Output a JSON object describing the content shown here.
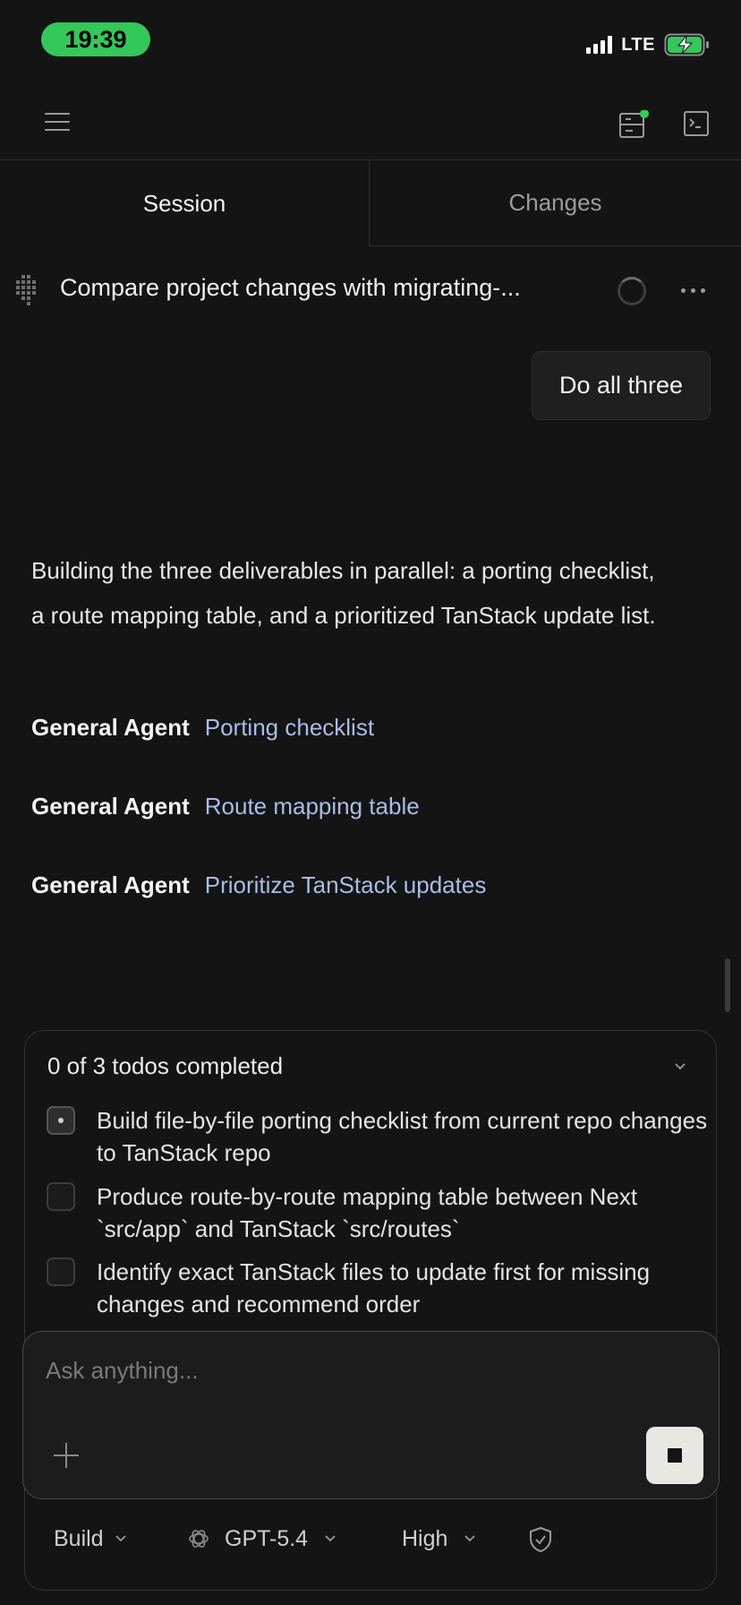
{
  "status_bar": {
    "time": "19:39",
    "network": "LTE"
  },
  "tabs": [
    {
      "label": "Session",
      "active": true
    },
    {
      "label": "Changes",
      "active": false
    }
  ],
  "session": {
    "title": "Compare project changes with migrating-..."
  },
  "messages": {
    "user": "Do all three",
    "assistant": "Building the three deliverables in parallel: a porting checklist, a route mapping table, and a prioritized TanStack update list.",
    "agents": [
      {
        "name": "General Agent",
        "task": "Porting checklist"
      },
      {
        "name": "General Agent",
        "task": "Route mapping table"
      },
      {
        "name": "General Agent",
        "task": "Prioritize TanStack updates"
      }
    ]
  },
  "todos": {
    "summary": "0 of 3 todos completed",
    "items": [
      {
        "text": "Build file-by-file porting checklist from current repo changes to TanStack repo",
        "state": "in_progress"
      },
      {
        "text": "Produce route-by-route mapping table between Next `src/app` and TanStack `src/routes`",
        "state": "pending"
      },
      {
        "text": "Identify exact TanStack files to update first for missing changes and recommend order",
        "state": "pending"
      }
    ]
  },
  "composer": {
    "placeholder": "Ask anything...",
    "value": ""
  },
  "options": {
    "mode": "Build",
    "model": "GPT-5.4",
    "effort": "High"
  },
  "colors": {
    "background": "#141414",
    "accent_green": "#34c759",
    "agent_link": "#a9bde8",
    "notification_dot": "#30d158"
  }
}
